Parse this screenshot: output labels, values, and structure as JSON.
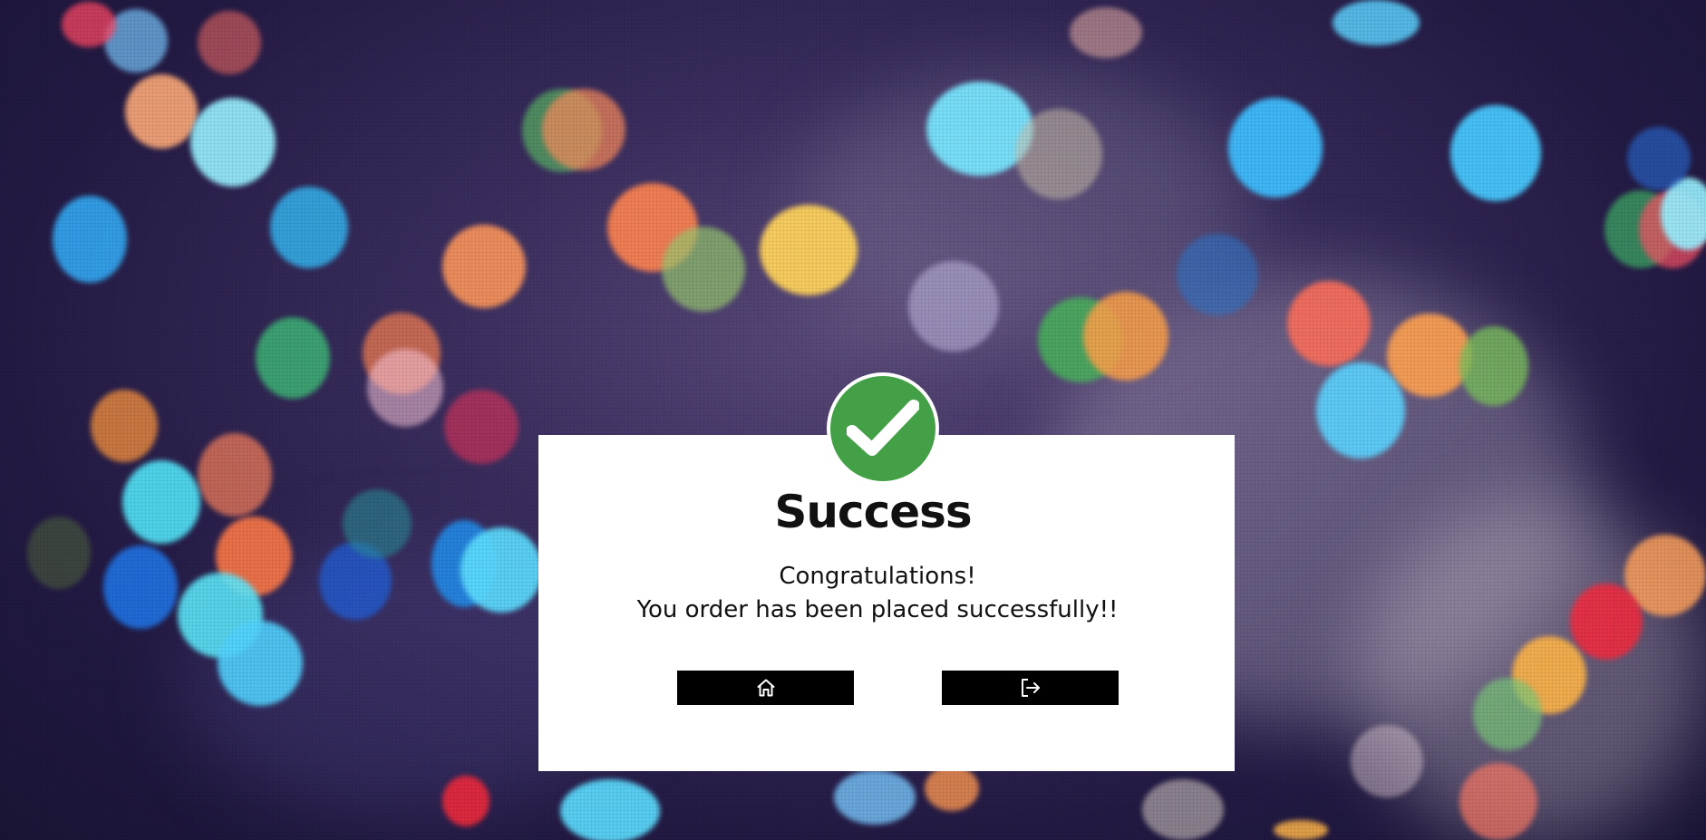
{
  "dialog": {
    "title": "Success",
    "message_line1": "Congratulations!",
    "message_line2": "You order has been placed successfully!!",
    "status_icon": "check-circle-icon",
    "status_color": "#43a047"
  },
  "actions": {
    "home": {
      "icon": "home-icon"
    },
    "logout": {
      "icon": "logout-icon"
    }
  },
  "background": {
    "style": "bokeh lights",
    "base_color": "#2a2250"
  }
}
